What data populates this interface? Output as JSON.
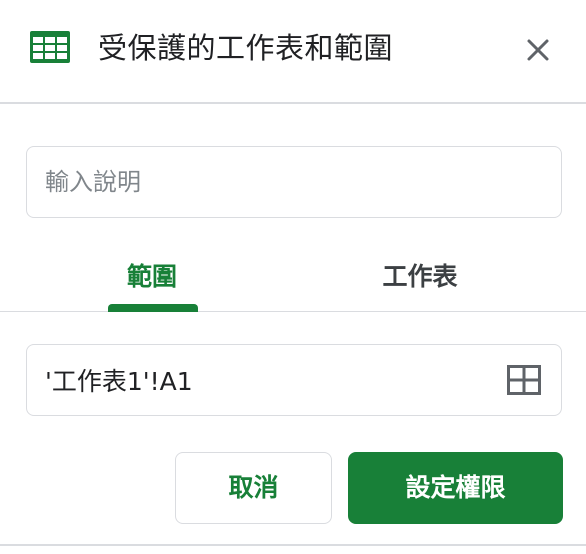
{
  "header": {
    "title": "受保護的工作表和範圍",
    "icon": "google-sheets-icon",
    "close_icon": "close-icon"
  },
  "description": {
    "placeholder": "輸入說明",
    "value": ""
  },
  "tabs": [
    {
      "label": "範圍",
      "active": true
    },
    {
      "label": "工作表",
      "active": false
    }
  ],
  "range": {
    "value": "'工作表1'!A1",
    "icon": "grid-select-icon"
  },
  "actions": {
    "cancel_label": "取消",
    "confirm_label": "設定權限"
  },
  "colors": {
    "accent": "#188038",
    "border": "#dadce0",
    "text": "#202124",
    "placeholder": "#80868b"
  }
}
